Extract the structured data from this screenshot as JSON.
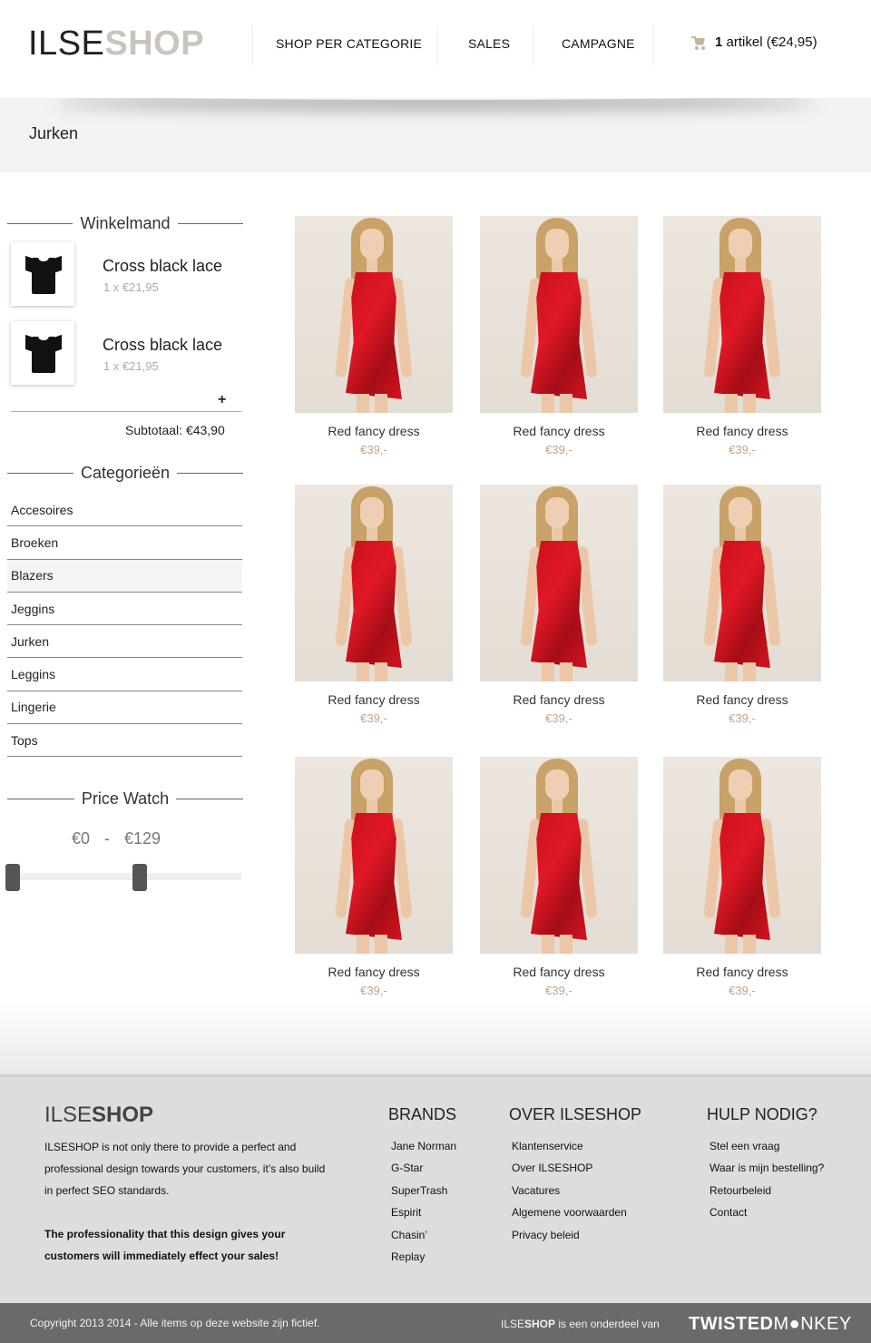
{
  "header": {
    "logo_light": "ILSE",
    "logo_bold": "SHOP",
    "nav": [
      "SHOP PER CATEGORIE",
      "SALES",
      "CAMPAGNE"
    ],
    "cart_count": "1",
    "cart_text": "artikel (€24,95)",
    "cart_icon": "cart-icon"
  },
  "page": {
    "title": "Jurken"
  },
  "sidebar": {
    "cart_heading": "Winkelmand",
    "cart_items": [
      {
        "name": "Cross black lace",
        "qty": "1 x €21,95"
      },
      {
        "name": "Cross black lace",
        "qty": "1 x €21,95"
      }
    ],
    "expand_symbol": "+",
    "subtotal": "Subtotaal: €43,90",
    "categories_heading": "Categorieën",
    "categories": [
      "Accesoires",
      "Broeken",
      "Blazers",
      "Jeggins",
      "Jurken",
      "Leggins",
      "Lingerie",
      "Tops"
    ],
    "active_category": "Blazers",
    "price_heading": "Price Watch",
    "price_min": "€0",
    "price_sep": "-",
    "price_max": "€129",
    "price_slider": {
      "min": 0,
      "max": 129,
      "track_max_fraction_left_handle": 0.0,
      "track_max_fraction_right_handle": 0.56
    }
  },
  "products": [
    {
      "name": "Red fancy dress",
      "price": "€39,-"
    },
    {
      "name": "Red fancy dress",
      "price": "€39,-"
    },
    {
      "name": "Red fancy dress",
      "price": "€39,-"
    },
    {
      "name": "Red fancy dress",
      "price": "€39,-"
    },
    {
      "name": "Red fancy dress",
      "price": "€39,-"
    },
    {
      "name": "Red fancy dress",
      "price": "€39,-"
    },
    {
      "name": "Red fancy dress",
      "price": "€39,-"
    },
    {
      "name": "Red fancy dress",
      "price": "€39,-"
    },
    {
      "name": "Red fancy dress",
      "price": "€39,-"
    }
  ],
  "footer": {
    "logo_light": "ILSE",
    "logo_bold": "SHOP",
    "about_text": "ILSESHOP is not only there to provide a perfect and professional design towards your customers, it’s also build in perfect SEO standards.",
    "about_bold": "The professionality that this design gives your customers will immediately effect your sales!",
    "columns": [
      {
        "title": "BRANDS",
        "links": [
          "Jane Norman",
          "G-Star",
          "SuperTrash",
          "Espirit",
          "Chasin’",
          "Replay"
        ]
      },
      {
        "title": "OVER ILSESHOP",
        "links": [
          "Klantenservice",
          "Over ILSESHOP",
          "Vacatures",
          "Algemene voorwaarden",
          "Privacy beleid"
        ]
      },
      {
        "title": "HULP NODIG?",
        "links": [
          "Stel een vraag",
          "Waar is mijn bestelling?",
          "Retourbeleid",
          "Contact"
        ]
      }
    ],
    "copyright": "Copyright 2013 2014 - Alle items op deze website zijn fictief.",
    "subsidiary_light": "ILSE",
    "subsidiary_bold": "SHOP",
    "subsidiary_text": " is een onderdeel van",
    "partner_bold": "TWISTED",
    "partner_light": "M●NKEY"
  },
  "colors": {
    "accent_price": "#c4a388",
    "logo_shop": "#c9c4bd",
    "bottom_bar": "#6a6a6a"
  }
}
